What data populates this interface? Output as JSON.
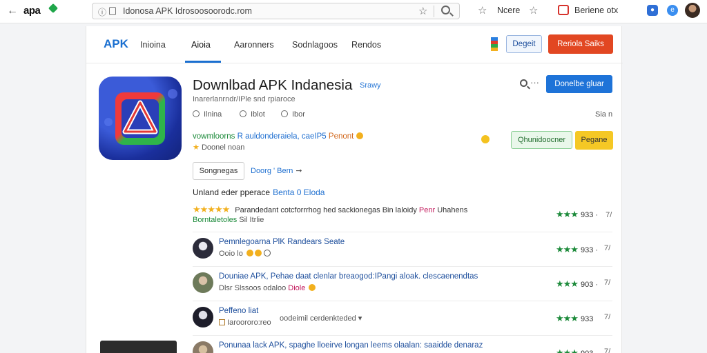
{
  "browser": {
    "brand": "apa",
    "url": "Idonosa APK Idrosoosoorodc.rom",
    "bookmark_label": "Ncere",
    "extension_label": "Beriene otx"
  },
  "nav": {
    "logo": "APK",
    "items": [
      "Inioina",
      "Aioia",
      "Aaronners",
      "Sodnlagoos",
      "Rendos"
    ],
    "login_label": "Degeit",
    "cta_label": "Reriola Saiks"
  },
  "app": {
    "title": "Downlbad APK Indanesia",
    "badge": "Srawy",
    "subtitle": "Inarerlanrndr/IPle snd rpiaroce",
    "meta": [
      "Ilnina",
      "Iblot",
      "Ibor"
    ],
    "meta_right": "Sia n",
    "download_line": {
      "green": "vowmloorns",
      "blue": "R auldonderaiela, caeIP5",
      "orange": "Penont"
    },
    "rating_text": "Doonel noan",
    "primary_label": "Donelbe gluar",
    "green_label": "Qhunidoocner",
    "yellow_label": "Pegane",
    "settings_label": "Songnegas",
    "more_link": "Doorg ' Bern"
  },
  "reviews": {
    "section_title": "Unland eder pperace",
    "section_blue": "Benta 0  Eloda",
    "top": {
      "text": "Parandedant cotcforrrhog hed sackionegas Bin laloidy",
      "pink": "Penr",
      "tail": "Uhahens",
      "line2": "Borntaletoles",
      "line2_gray": "Sil Itrlie",
      "score": "933 ·",
      "chev": "7/"
    },
    "rows": [
      {
        "name": "Pemnlegoarna PlK Randears Seate",
        "sub": "Ooio lo",
        "pink": "",
        "score": "933 ·",
        "chev": "7/"
      },
      {
        "name": "Douniae APK, Pehae daat clenlar breaogod:IPangi aloak. clescaenendtas",
        "sub": "Dlsr Slssoos odaloo",
        "pink": "Diole",
        "score": "903 ·",
        "chev": "7/"
      },
      {
        "name": "Peffeno liat",
        "sub": "Iaroororo:reo",
        "extra": "oodeimil cerdenkteded",
        "pink": "",
        "score": "933",
        "chev": "7/"
      },
      {
        "name": "Ponunaa lack APK, spaghe lloeirve longan leems olaalan: saaidde denaraz",
        "sub": "",
        "pink": "",
        "score": "903",
        "chev": "7/"
      }
    ]
  }
}
